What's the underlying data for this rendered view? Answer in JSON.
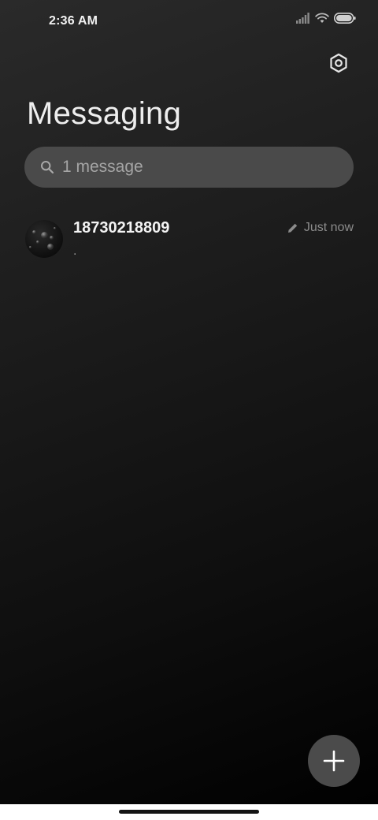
{
  "status_bar": {
    "time": "2:36 AM",
    "icons": [
      "signal-icon",
      "wifi-icon",
      "battery-icon"
    ]
  },
  "header": {
    "title": "Messaging",
    "settings_icon": "settings-icon"
  },
  "search": {
    "placeholder": "1 message",
    "icon": "search-icon"
  },
  "conversations": [
    {
      "name": "18730218809",
      "snippet": ".",
      "timestamp": "Just now",
      "draft_icon": "pencil-icon"
    }
  ],
  "fab": {
    "icon": "plus-icon"
  },
  "colors": {
    "background_top": "#2a2a2a",
    "background_bottom": "#000000",
    "search_bg": "#4a4a4a",
    "fab_bg": "#4b4b4b",
    "nav_bar": "#ffffff"
  }
}
